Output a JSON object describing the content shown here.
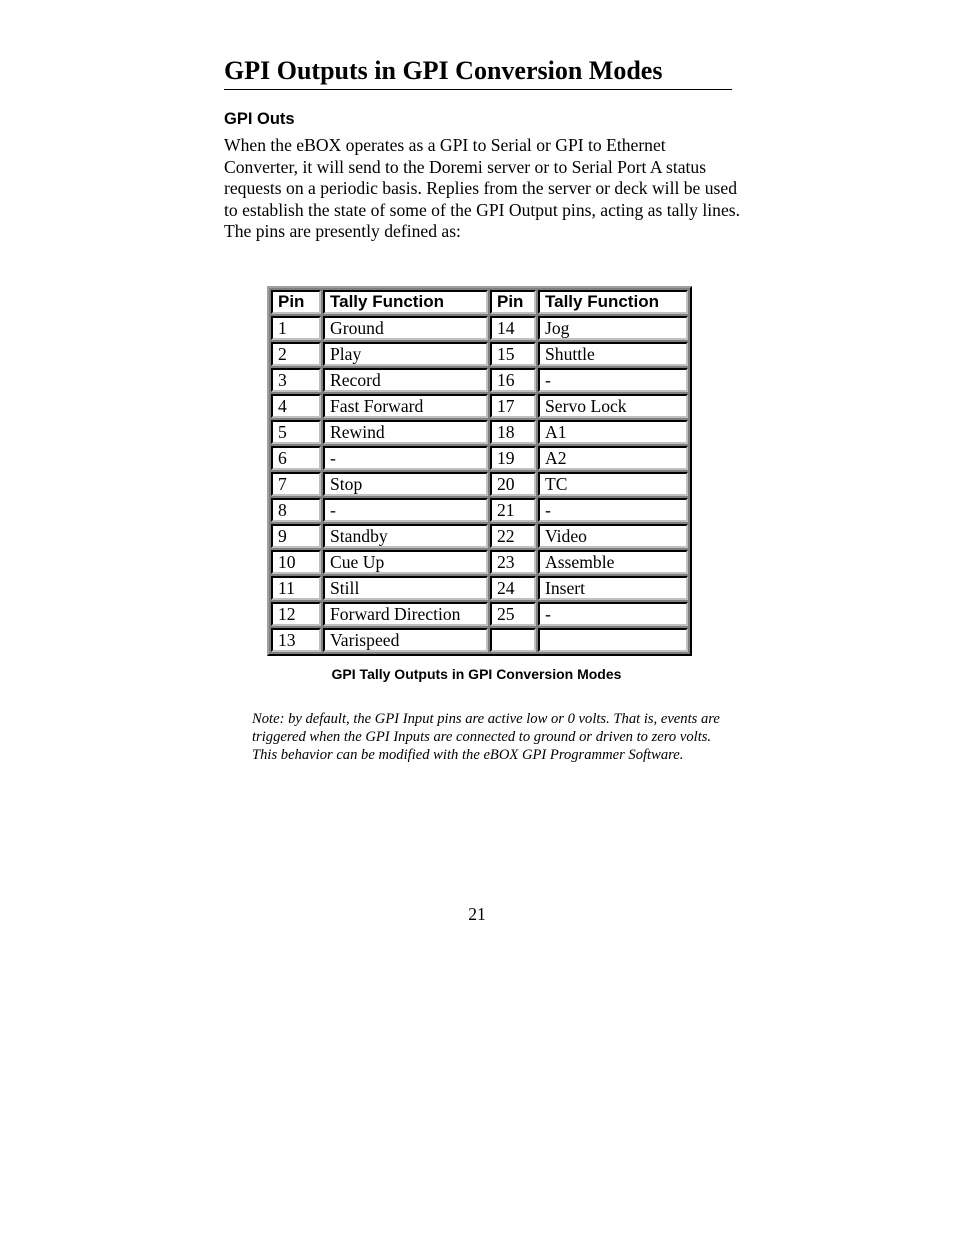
{
  "page": {
    "title": "GPI Outputs in GPI Conversion Modes",
    "section_heading": "GPI Outs",
    "body_text": "When the eBOX operates as a GPI to Serial or GPI to Ethernet Converter, it will send to the Doremi server or to Serial Port A status requests on a periodic basis.  Replies from the server or deck will be used to establish the state of some of the GPI Output pins, acting as tally lines.  The pins are presently defined as:",
    "table": {
      "headers": [
        "Pin",
        "Tally Function",
        "Pin",
        "Tally Function"
      ],
      "rows": [
        [
          "1",
          "Ground",
          "14",
          "Jog"
        ],
        [
          "2",
          "Play",
          "15",
          "Shuttle"
        ],
        [
          "3",
          "Record",
          "16",
          "-"
        ],
        [
          "4",
          "Fast Forward",
          "17",
          "Servo Lock"
        ],
        [
          "5",
          "Rewind",
          "18",
          "A1"
        ],
        [
          "6",
          "-",
          "19",
          "A2"
        ],
        [
          "7",
          "Stop",
          "20",
          "TC"
        ],
        [
          "8",
          "-",
          "21",
          "-"
        ],
        [
          "9",
          "Standby",
          "22",
          "Video"
        ],
        [
          "10",
          "Cue Up",
          "23",
          "Assemble"
        ],
        [
          "11",
          "Still",
          "24",
          "Insert"
        ],
        [
          "12",
          "Forward Direction",
          "25",
          "-"
        ],
        [
          "13",
          "Varispeed",
          "",
          ""
        ]
      ],
      "caption": "GPI Tally Outputs in GPI Conversion Modes"
    },
    "note": "Note:  by default, the GPI Input pins are active low or 0 volts.  That is, events are triggered when the GPI Inputs are connected to ground or driven to zero volts.  This behavior can be modified with the eBOX GPI Programmer Software.",
    "page_number": "21"
  }
}
